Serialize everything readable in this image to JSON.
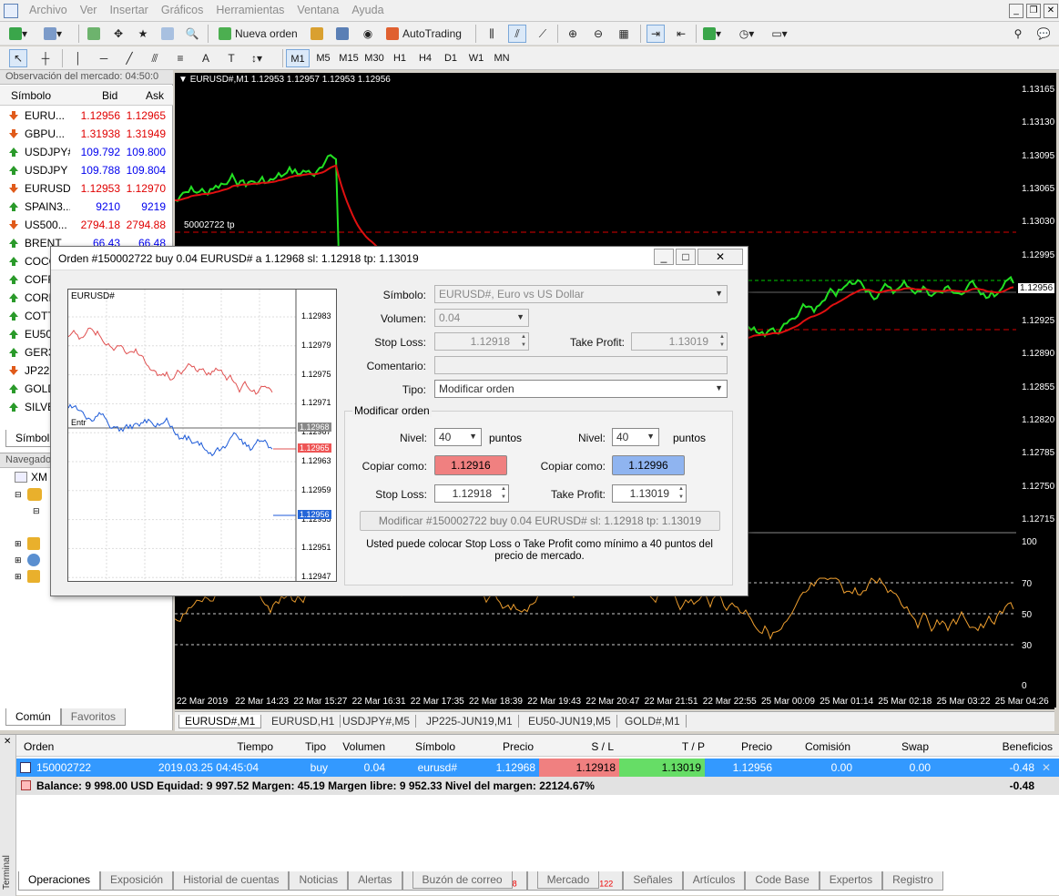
{
  "menu": [
    "Archivo",
    "Ver",
    "Insertar",
    "Gráficos",
    "Herramientas",
    "Ventana",
    "Ayuda"
  ],
  "toolbar": {
    "new_order": "Nueva orden",
    "autotrading": "AutoTrading"
  },
  "timeframes": [
    "M1",
    "M5",
    "M15",
    "M30",
    "H1",
    "H4",
    "D1",
    "W1",
    "MN"
  ],
  "market_watch": {
    "title": "Observación del mercado: 04:50:0",
    "col_symbol": "Símbolo",
    "col_bid": "Bid",
    "col_ask": "Ask",
    "rows": [
      {
        "sym": "EURU...",
        "bid": "1.12956",
        "ask": "1.12965",
        "dir": "down"
      },
      {
        "sym": "GBPU...",
        "bid": "1.31938",
        "ask": "1.31949",
        "dir": "down"
      },
      {
        "sym": "USDJPY#",
        "bid": "109.792",
        "ask": "109.800",
        "dir": "up"
      },
      {
        "sym": "USDJPY",
        "bid": "109.788",
        "ask": "109.804",
        "dir": "up"
      },
      {
        "sym": "EURUSD",
        "bid": "1.12953",
        "ask": "1.12970",
        "dir": "down"
      },
      {
        "sym": "SPAIN3...",
        "bid": "9210",
        "ask": "9219",
        "dir": "up"
      },
      {
        "sym": "US500...",
        "bid": "2794.18",
        "ask": "2794.88",
        "dir": "down"
      },
      {
        "sym": "BRENT",
        "bid": "66.43",
        "ask": "66.48",
        "dir": "up"
      },
      {
        "sym": "COCO",
        "bid": "",
        "ask": "",
        "dir": "up"
      },
      {
        "sym": "COFF",
        "bid": "",
        "ask": "",
        "dir": "up"
      },
      {
        "sym": "CORN",
        "bid": "",
        "ask": "",
        "dir": "up"
      },
      {
        "sym": "COTT",
        "bid": "",
        "ask": "",
        "dir": "up"
      },
      {
        "sym": "EU50-",
        "bid": "",
        "ask": "",
        "dir": "up"
      },
      {
        "sym": "GER30",
        "bid": "",
        "ask": "",
        "dir": "up"
      },
      {
        "sym": "JP225",
        "bid": "",
        "ask": "",
        "dir": "down"
      },
      {
        "sym": "GOLD",
        "bid": "",
        "ask": "",
        "dir": "up"
      },
      {
        "sym": "SILVE",
        "bid": "",
        "ask": "",
        "dir": "up"
      }
    ],
    "tab": "Símbol"
  },
  "navigator": {
    "title": "Navegado",
    "root": "XM",
    "tabs": [
      "Común",
      "Favoritos"
    ]
  },
  "chart": {
    "header": "EURUSD#,M1  1.12953 1.12957 1.12953 1.12956",
    "order_line_label": "50002722 tp",
    "price_labels": [
      "1.13165",
      "1.13130",
      "1.13095",
      "1.13065",
      "1.13030",
      "1.12995",
      "1.12956",
      "1.12925",
      "1.12890",
      "1.12855",
      "1.12820",
      "1.12785",
      "1.12750",
      "1.12715"
    ],
    "current_price": "1.12956",
    "rsi_labels": [
      "100",
      "70",
      "50",
      "30",
      "0"
    ],
    "time_labels": [
      "22 Mar 2019",
      "22 Mar 14:23",
      "22 Mar 15:27",
      "22 Mar 16:31",
      "22 Mar 17:35",
      "22 Mar 18:39",
      "22 Mar 19:43",
      "22 Mar 20:47",
      "22 Mar 21:51",
      "22 Mar 22:55",
      "25 Mar 00:09",
      "25 Mar 01:14",
      "25 Mar 02:18",
      "25 Mar 03:22",
      "25 Mar 04:26"
    ],
    "tabs": [
      "EURUSD#,M1",
      "EURUSD,H1",
      "USDJPY#,M5",
      "JP225-JUN19,M1",
      "EU50-JUN19,M5",
      "GOLD#,M1"
    ]
  },
  "dialog": {
    "title": "Orden #150002722 buy 0.04 EURUSD# a 1.12968 sl: 1.12918 tp: 1.13019",
    "mini_symbol": "EURUSD#",
    "mini_entry": "Entr",
    "mini_prices": [
      "1.12983",
      "1.12979",
      "1.12975",
      "1.12971",
      "1.12967",
      "1.12963",
      "1.12959",
      "1.12955",
      "1.12951",
      "1.12947"
    ],
    "mini_entry_price": "1.12968",
    "mini_ask": "1.12965",
    "mini_bid": "1.12956",
    "symbol_label": "Símbolo:",
    "symbol_value": "EURUSD#, Euro vs US Dollar",
    "volume_label": "Volumen:",
    "volume_value": "0.04",
    "sl_label": "Stop Loss:",
    "sl_value": "1.12918",
    "tp_label": "Take Profit:",
    "tp_value": "1.13019",
    "comment_label": "Comentario:",
    "comment_value": "",
    "type_label": "Tipo:",
    "type_value": "Modificar orden",
    "group_title": "Modificar orden",
    "level_label": "Nivel:",
    "level_left": "40",
    "level_right": "40",
    "points": "puntos",
    "copy_label": "Copiar como:",
    "copy_left": "1.12916",
    "copy_right": "1.12996",
    "sl2_label": "Stop Loss:",
    "sl2_value": "1.12918",
    "tp2_label": "Take Profit:",
    "tp2_value": "1.13019",
    "modify_button": "Modificar #150002722 buy 0.04 EURUSD# sl: 1.12918 tp: 1.13019",
    "note": "Usted puede colocar Stop Loss o Take Profit como mínimo a 40 puntos del precio de mercado.",
    "accent_sl": "#f08080",
    "accent_tp": "#8fb4f0"
  },
  "terminal": {
    "side": "Terminal",
    "cols": [
      "Orden",
      "Tiempo",
      "Tipo",
      "Volumen",
      "Símbolo",
      "Precio",
      "S / L",
      "T / P",
      "Precio",
      "Comisión",
      "Swap",
      "Beneficios"
    ],
    "order": {
      "id": "150002722",
      "time": "2019.03.25 04:45:04",
      "type": "buy",
      "volume": "0.04",
      "symbol": "eurusd#",
      "price": "1.12968",
      "sl": "1.12918",
      "tp": "1.13019",
      "cur": "1.12956",
      "commission": "0.00",
      "swap": "0.00",
      "profit": "-0.48"
    },
    "balance": "Balance: 9 998.00 USD  Equidad: 9 997.52  Margen: 45.19  Margen libre: 9 952.33  Nivel del margen: 22124.67%",
    "balance_profit": "-0.48",
    "tabs": [
      "Operaciones",
      "Exposición",
      "Historial de cuentas",
      "Noticias",
      "Alertas",
      "Buzón de correo",
      "Mercado",
      "Señales",
      "Artículos",
      "Code Base",
      "Expertos",
      "Registro"
    ],
    "mail_count": "8",
    "market_count": "122"
  }
}
